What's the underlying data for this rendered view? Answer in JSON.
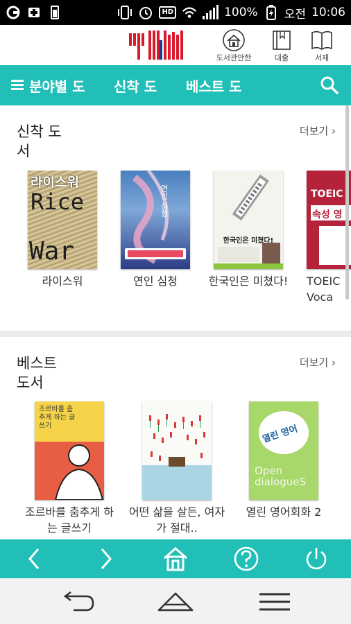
{
  "status_bar": {
    "battery_percent": "100%",
    "carrier_label": "오전",
    "time": "10:06",
    "hd_label": "HD"
  },
  "header": {
    "logo_text": "YBM",
    "buttons": [
      {
        "label": "도서관안한",
        "icon": "library-house-icon"
      },
      {
        "label": "대출",
        "icon": "borrow-book-icon"
      },
      {
        "label": "서재",
        "icon": "bookshelf-icon"
      }
    ]
  },
  "tabs": {
    "category": "분야별 도",
    "new_books": "신착 도",
    "best_books": "베스트 도"
  },
  "sections": {
    "new": {
      "title": "신착 도서",
      "more": "더보기",
      "books": [
        {
          "title": "라이스워",
          "cover_line1": "라이스워",
          "cover_line2": "Rice",
          "cover_line3": "War"
        },
        {
          "title": "연인 심청",
          "cover_line1": "연인 심청",
          "cover_line2": "",
          "cover_line3": ""
        },
        {
          "title": "한국인은 미쳤다!",
          "cover_line1": "한국인은 미쳤다!",
          "cover_line2": "",
          "cover_line3": ""
        },
        {
          "title": "TOEIC Voca",
          "cover_line1": "TOEIC",
          "cover_line2": "속성 영",
          "cover_line3": ""
        }
      ]
    },
    "best": {
      "title": "베스트 도서",
      "more": "더보기",
      "books": [
        {
          "title": "조르바를 춤추게 하는 글쓰기",
          "cover_line1": "조르바를 춤추게 하는 글쓰기"
        },
        {
          "title": "어떤 삶을 살든, 여자가 절대..",
          "cover_line1": ""
        },
        {
          "title": "열린 영어회화 2",
          "cover_line1": "열린 영어",
          "cover_line2": "Open dialogueS"
        }
      ]
    }
  },
  "colors": {
    "accent": "#21bfb7",
    "logo_red": "#d91a2a"
  },
  "bottom_nav": [
    "back-arrow-icon",
    "forward-arrow-icon",
    "home-icon",
    "help-icon",
    "power-icon"
  ],
  "system_nav": [
    "system-back-icon",
    "system-home-icon",
    "system-menu-icon"
  ]
}
